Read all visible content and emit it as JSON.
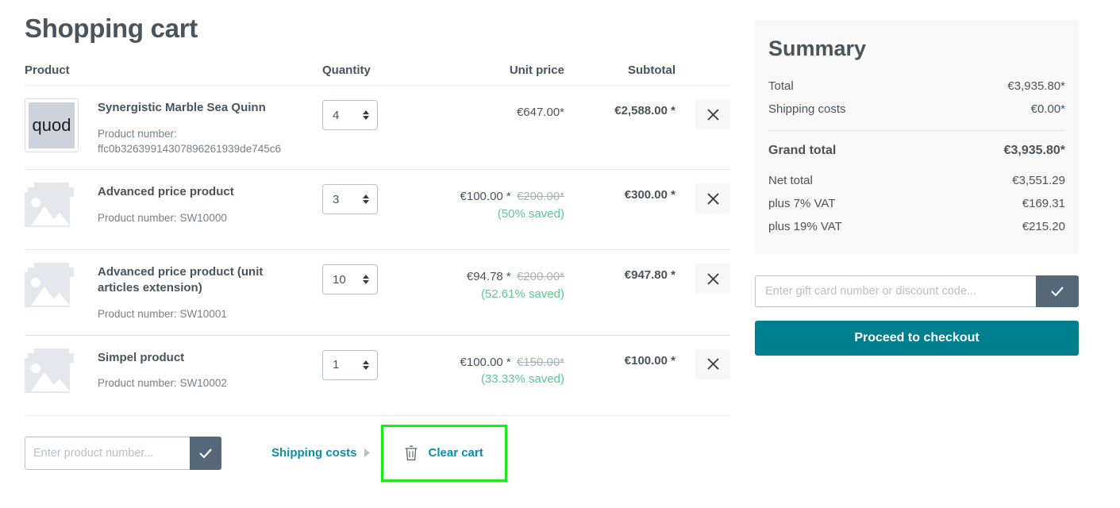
{
  "page": {
    "title": "Shopping cart"
  },
  "table": {
    "headers": {
      "product": "Product",
      "quantity": "Quantity",
      "unit_price": "Unit price",
      "subtotal": "Subtotal"
    },
    "rows": [
      {
        "name": "Synergistic Marble Sea Quinn",
        "product_number_label": "Product number:",
        "product_number": "ffc0b32639914307896261939de745c6",
        "thumb_type": "text",
        "thumb_text": "quod",
        "quantity": "4",
        "unit_price": "€647.00*",
        "old_price": "",
        "saved": "",
        "subtotal": "€2,588.00 *"
      },
      {
        "name": "Advanced price product",
        "product_number_label": "Product number: SW10000",
        "product_number": "",
        "thumb_type": "placeholder",
        "thumb_text": "",
        "quantity": "3",
        "unit_price": "€100.00 *",
        "old_price": "€200.00*",
        "saved": "(50% saved)",
        "subtotal": "€300.00 *"
      },
      {
        "name": "Advanced price product (unit articles extension)",
        "product_number_label": "Product number: SW10001",
        "product_number": "",
        "thumb_type": "placeholder",
        "thumb_text": "",
        "quantity": "10",
        "unit_price": "€94.78 *",
        "old_price": "€200.00*",
        "saved": "(52.61% saved)",
        "subtotal": "€947.80 *"
      },
      {
        "name": "Simpel product",
        "product_number_label": "Product number: SW10002",
        "product_number": "",
        "thumb_type": "placeholder",
        "thumb_text": "",
        "quantity": "1",
        "unit_price": "€100.00 *",
        "old_price": "€150.00*",
        "saved": "(33.33% saved)",
        "subtotal": "€100.00 *"
      }
    ]
  },
  "actions": {
    "product_number_placeholder": "Enter product number...",
    "product_number_value": "",
    "submit_icon": "check-icon",
    "shipping_costs_label": "Shipping costs",
    "clear_cart_label": "Clear cart",
    "clear_cart_icon": "trash-icon",
    "highlight_color": "#15ed15"
  },
  "summary": {
    "title": "Summary",
    "lines": [
      {
        "label": "Total",
        "value": "€3,935.80*"
      },
      {
        "label": "Shipping costs",
        "value": "€0.00*"
      }
    ],
    "grand": {
      "label": "Grand total",
      "value": "€3,935.80*"
    },
    "tax_lines": [
      {
        "label": "Net total",
        "value": "€3,551.29"
      },
      {
        "label": "plus 7% VAT",
        "value": "€169.31"
      },
      {
        "label": "plus 19% VAT",
        "value": "€215.20"
      }
    ],
    "promo_placeholder": "Enter gift card number or discount code...",
    "promo_value": "",
    "promo_submit_icon": "check-icon",
    "checkout_label": "Proceed to checkout",
    "checkout_color": "#00808f"
  }
}
